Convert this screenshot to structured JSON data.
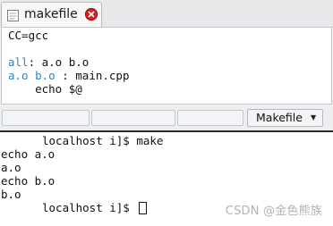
{
  "editor": {
    "tab": {
      "filename": "makefile",
      "file_icon": "document-icon",
      "close_icon": "close-icon"
    },
    "code_lines": [
      {
        "parts": [
          {
            "text": "CC=gcc",
            "kind": "plain"
          }
        ]
      },
      {
        "parts": [
          {
            "text": "",
            "kind": "plain"
          }
        ]
      },
      {
        "parts": [
          {
            "text": "all",
            "kind": "target"
          },
          {
            "text": ": a.o b.o",
            "kind": "plain"
          }
        ]
      },
      {
        "parts": [
          {
            "text": "a.o b.o",
            "kind": "target"
          },
          {
            "text": " : main.cpp",
            "kind": "plain"
          }
        ]
      },
      {
        "parts": [
          {
            "text": "    echo $@",
            "kind": "plain"
          }
        ]
      }
    ],
    "status": {
      "language": "Makefile",
      "dropdown_icon": "caret-down-icon"
    },
    "colors": {
      "target": "#2a85c8",
      "close_button": "#d81e1e"
    }
  },
  "terminal": {
    "lines": [
      {
        "text": "localhost i]$ make",
        "masked_prefix": true
      },
      {
        "text": "echo a.o",
        "masked_prefix": false
      },
      {
        "text": "a.o",
        "masked_prefix": false
      },
      {
        "text": "echo b.o",
        "masked_prefix": false
      },
      {
        "text": "b.o",
        "masked_prefix": false
      },
      {
        "text": "localhost i]$ ",
        "masked_prefix": true,
        "cursor": true
      }
    ]
  },
  "watermark": "CSDN @金色熊族"
}
